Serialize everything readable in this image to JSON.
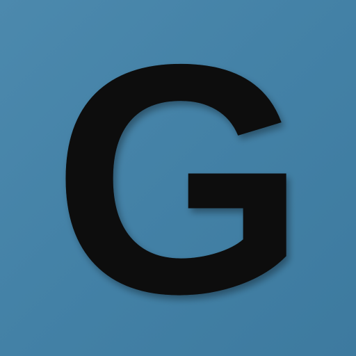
{
  "tile": {
    "letter": "G",
    "background_color": "#4584a9",
    "letter_color": "#0a0a0a"
  }
}
